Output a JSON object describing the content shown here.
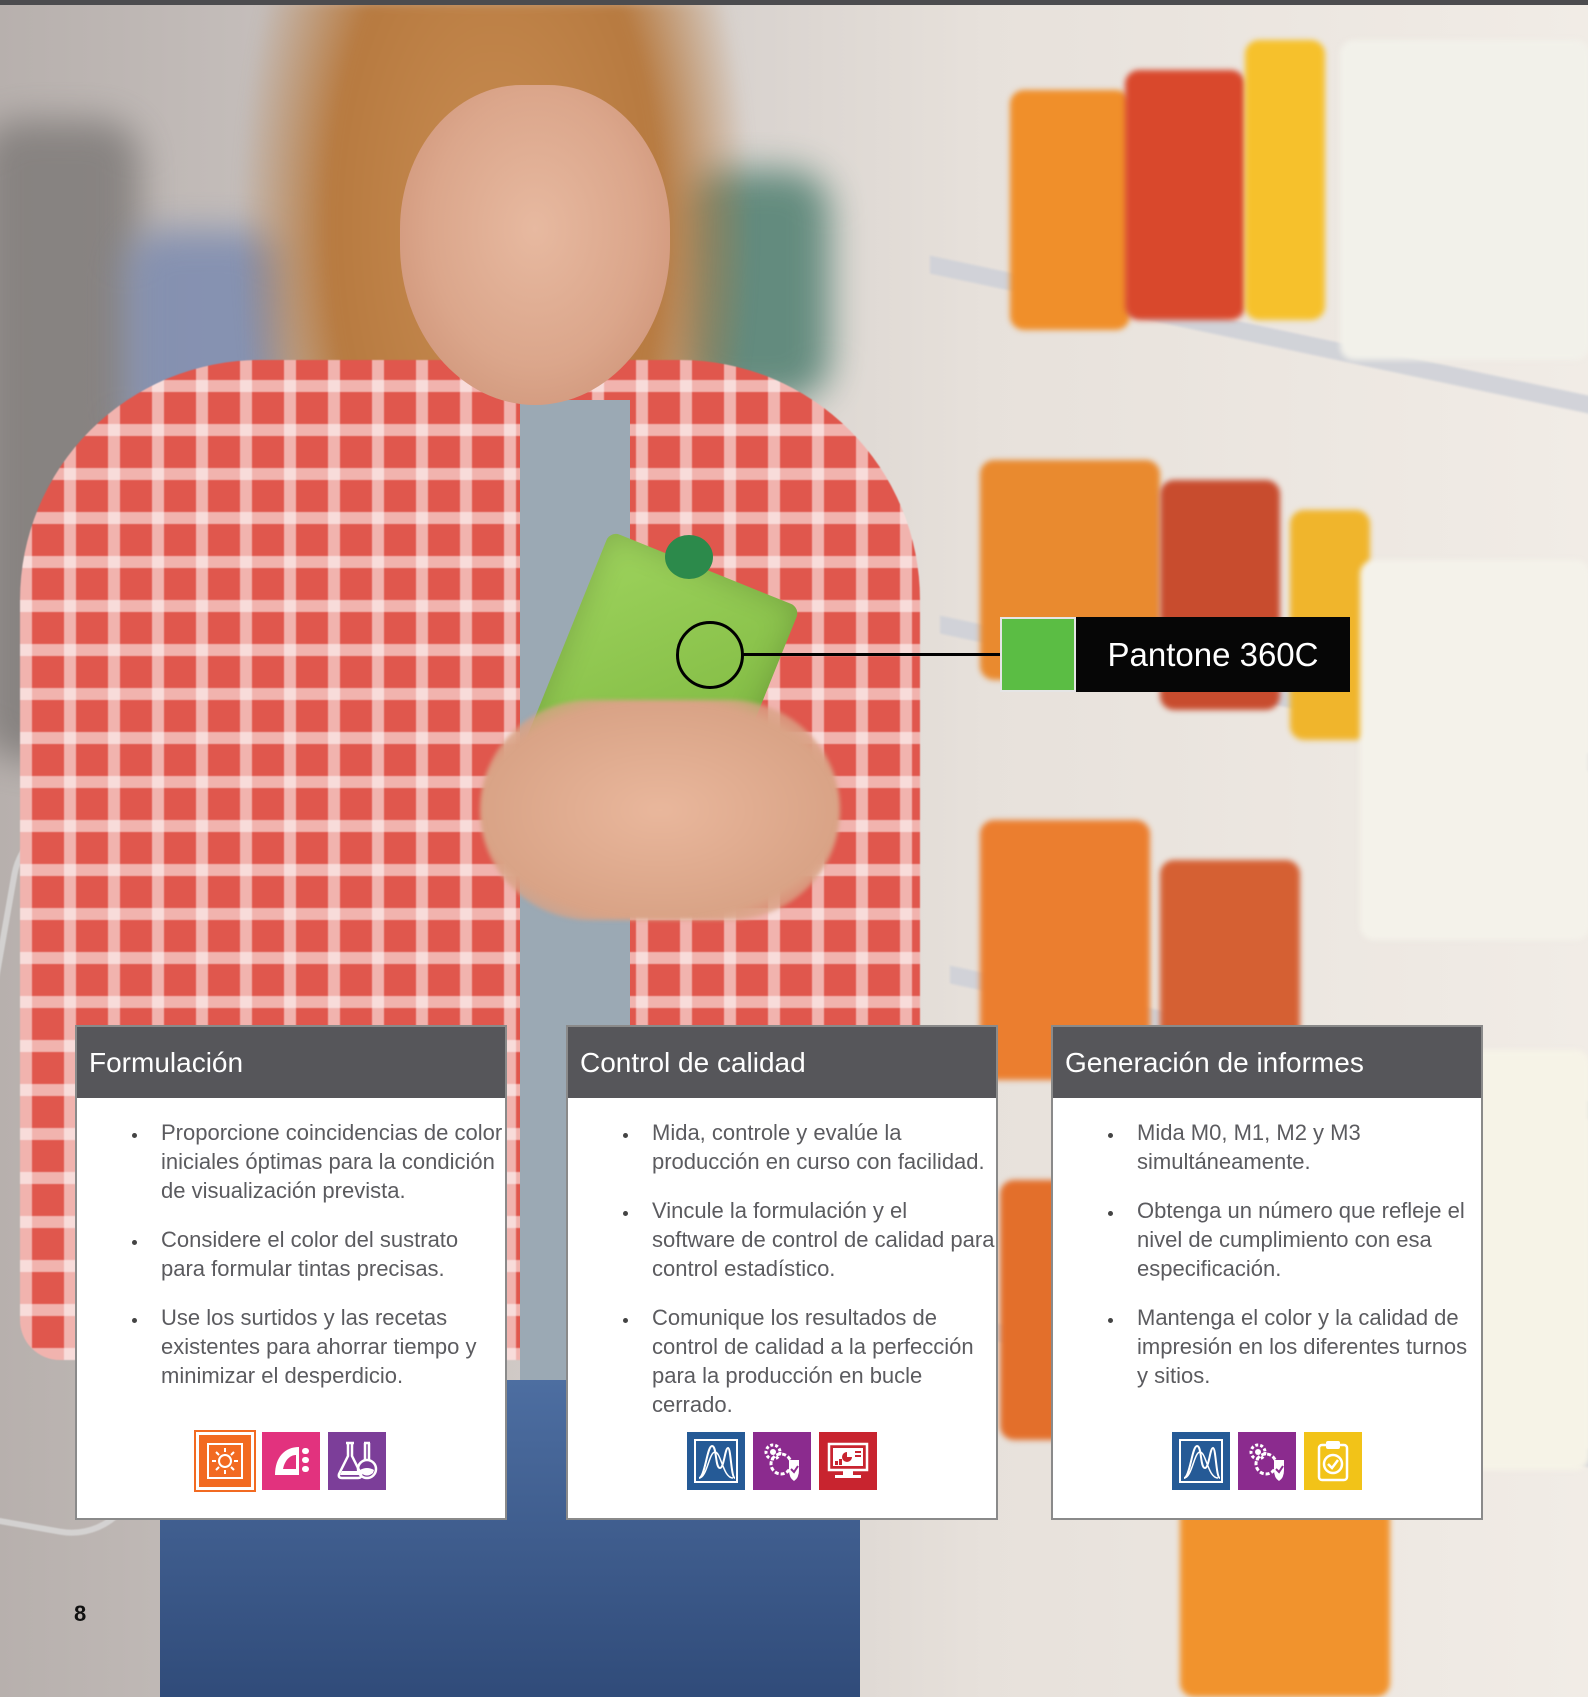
{
  "callout": {
    "label": "Pantone 360C",
    "swatch_color": "#5bbd44"
  },
  "cards": [
    {
      "title": "Formulación",
      "bullets": [
        "Proporcione coincidencias de color iniciales óptimas para la condición de visualización prevista.",
        "Considere el color del sustrato para formular tintas precisas.",
        "Use los surtidos y las recetas existentes para ahorrar tiempo y minimizar el desperdicio."
      ],
      "icons": [
        {
          "name": "lighting-icon",
          "color": "#f26a21"
        },
        {
          "name": "substrate-icon",
          "color": "#e2327e"
        },
        {
          "name": "flask-icon",
          "color": "#7c3e99"
        }
      ]
    },
    {
      "title": "Control de calidad",
      "bullets": [
        "Mida, controle y evalúe la producción en curso con facilidad.",
        "Vincule la formulación y el software de control de calidad para control estadístico.",
        "Comunique los resultados de control de calidad a la perfección para la producción en bucle cerrado."
      ],
      "icons": [
        {
          "name": "spectral-curve-icon",
          "color": "#255a96"
        },
        {
          "name": "gear-shield-icon",
          "color": "#8b2b8e"
        },
        {
          "name": "monitor-report-icon",
          "color": "#c8242f"
        }
      ]
    },
    {
      "title": "Generación de informes",
      "bullets": [
        "Mida M0, M1, M2 y M3 simultáneamente.",
        "Obtenga un número que refleje el nivel de cumplimiento con esa especificación.",
        "Mantenga el color y la calidad de impresión en los diferentes turnos y sitios."
      ],
      "icons": [
        {
          "name": "spectral-curve-icon",
          "color": "#255a96"
        },
        {
          "name": "gear-shield-icon",
          "color": "#8b2b8e"
        },
        {
          "name": "clipboard-check-icon",
          "color": "#f2c318"
        }
      ]
    }
  ],
  "page_number": "8"
}
